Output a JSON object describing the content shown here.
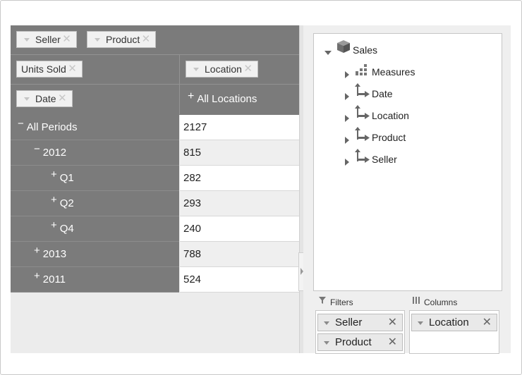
{
  "pivot": {
    "filter_chips": [
      {
        "label": "Seller"
      },
      {
        "label": "Product"
      }
    ],
    "measure_chip": "Units Sold",
    "column_chip": "Location",
    "row_chip": "Date",
    "column_member": "All Locations",
    "rows": [
      {
        "sign": "−",
        "label": "All Periods",
        "value": "2127"
      },
      {
        "sign": "−",
        "label": "2012",
        "value": "815"
      },
      {
        "sign": "+",
        "label": "Q1",
        "value": "282"
      },
      {
        "sign": "+",
        "label": "Q2",
        "value": "293"
      },
      {
        "sign": "+",
        "label": "Q4",
        "value": "240"
      },
      {
        "sign": "+",
        "label": "2013",
        "value": "788"
      },
      {
        "sign": "+",
        "label": "2011",
        "value": "524"
      }
    ]
  },
  "tree": {
    "root": "Sales",
    "children": [
      "Measures",
      "Date",
      "Location",
      "Product",
      "Seller"
    ]
  },
  "zones": {
    "filters_label": "Filters",
    "columns_label": "Columns",
    "filters": [
      "Seller",
      "Product"
    ],
    "columns": [
      "Location"
    ]
  },
  "glyphs": {
    "close": "✕",
    "close_zone": "✕"
  }
}
